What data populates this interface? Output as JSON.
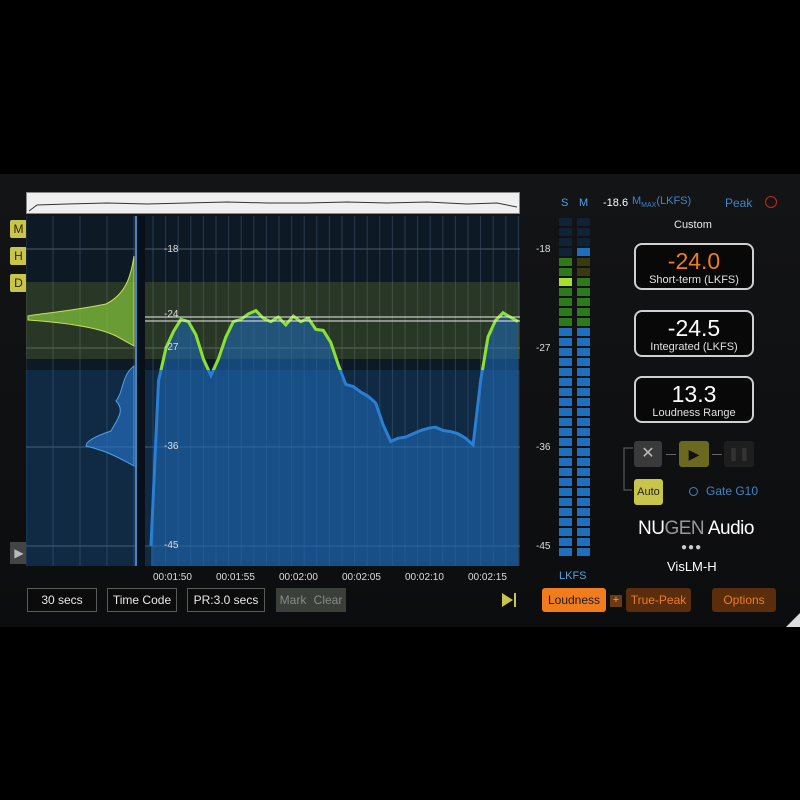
{
  "side_buttons": [
    "M",
    "H",
    "D"
  ],
  "graph": {
    "range_labels": [
      "-18",
      "-24",
      "-27",
      "-36",
      "-45"
    ],
    "time_labels": [
      "00:01:50",
      "00:01:55",
      "00:02:00",
      "00:02:05",
      "00:02:10",
      "00:02:15"
    ],
    "loudness_lkfs": [
      -45,
      -30,
      -27,
      -25.5,
      -24.4,
      -24.6,
      -25.8,
      -28,
      -29.5,
      -28,
      -26,
      -24.6,
      -24.4,
      -23.9,
      -23.6,
      -24.3,
      -24.6,
      -24.2,
      -24.9,
      -24.1,
      -24.6,
      -24.3,
      -25.3,
      -25.4,
      -26.5,
      -28.5,
      -30.3,
      -30.5,
      -31,
      -31.4,
      -32,
      -34,
      -35.5,
      -35.2,
      -35.1,
      -34.8,
      -34.5,
      -34.3,
      -34.2,
      -34.5,
      -34.6,
      -34.8,
      -35.2,
      -35.8,
      -30,
      -26,
      -24.5,
      -23.8,
      -24.2,
      -24.6
    ],
    "target_lkfs": -24.0,
    "tolerance_band_lkfs": [
      -28,
      -22
    ]
  },
  "meters": {
    "header_s": "S",
    "header_m": "M",
    "ticks": [
      "-18",
      "-27",
      "-36",
      "-45"
    ],
    "unit": "LKFS"
  },
  "top_bar": {
    "max_value": "-18.6",
    "max_label_m": "M",
    "max_label_sub": "MAX",
    "max_label_unit": "(LKFS)",
    "peak_label": "Peak",
    "preset": "Custom"
  },
  "readouts": {
    "short_term_value": "-24.0",
    "short_term_label": "Short-term (LKFS)",
    "integrated_value": "-24.5",
    "integrated_label": "Integrated (LKFS)",
    "range_value": "13.3",
    "range_label": "Loudness Range"
  },
  "transport": {
    "auto_label": "Auto",
    "gate_label": "Gate G10"
  },
  "brand": {
    "nu": "NU",
    "gen": "GEN",
    "audio": " Audio",
    "product": "VisLM-H"
  },
  "bottom": {
    "duration": "30 secs",
    "timecode": "Time Code",
    "pr": "PR:3.0 secs",
    "mark": "Mark",
    "clear": "Clear",
    "loudness": "Loudness",
    "plus": "+",
    "true_peak": "True-Peak",
    "options": "Options"
  },
  "colors": {
    "accent_orange": "#f07c1e",
    "green_line": "#8ee02e",
    "blue_fill": "#1e6fbd",
    "yellow_button": "#c9c44a"
  }
}
